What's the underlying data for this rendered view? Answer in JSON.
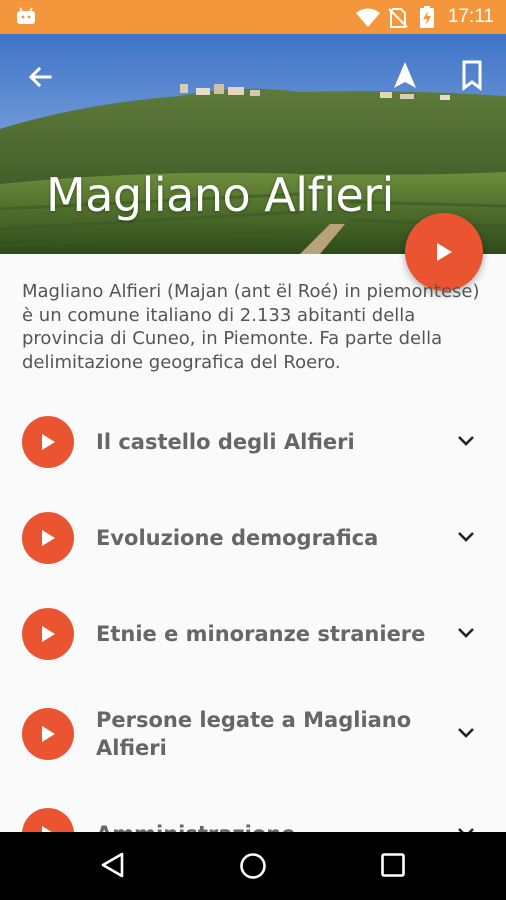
{
  "status_bar": {
    "time": "17:11"
  },
  "hero": {
    "title": "Magliano Alfieri"
  },
  "description": "Magliano Alfieri (Majan (ant ël Roé) in piemontese) è un comune italiano di 2.133 abitanti della provincia di Cuneo, in Piemonte. Fa parte della delimitazione geografica del Roero.",
  "sections": [
    {
      "label": "Il castello degli Alfieri"
    },
    {
      "label": "Evoluzione demografica"
    },
    {
      "label": "Etnie e minoranze straniere"
    },
    {
      "label": "Persone legate a Magliano Alfieri"
    },
    {
      "label": "Amministrazione"
    }
  ],
  "colors": {
    "status_bar": "#f4973c",
    "accent": "#ea5430"
  },
  "icons": [
    "android-icon",
    "wifi-icon",
    "no-sim-icon",
    "battery-charging-icon",
    "arrow-back-icon",
    "navigation-arrow-icon",
    "bookmark-icon",
    "play-icon",
    "chevron-down-icon",
    "nav-back-icon",
    "nav-home-icon",
    "nav-recents-icon"
  ]
}
